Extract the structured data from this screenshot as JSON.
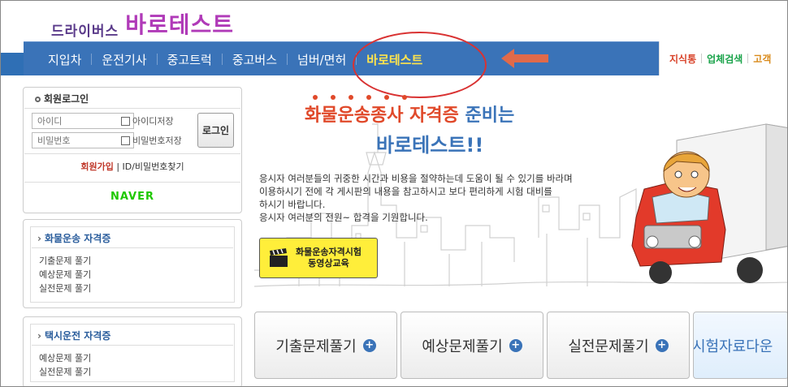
{
  "logo": {
    "sub": "드라이버스",
    "main": "바로테스트"
  },
  "nav": {
    "items": [
      "지입차",
      "운전기사",
      "중고트럭",
      "중고버스",
      "넘버/면허",
      "바로테스트"
    ],
    "right_items": [
      "지식통",
      "업체검색",
      "고객"
    ],
    "right_colors": [
      "#d9442b",
      "#1aa34a",
      "#d98a1a"
    ]
  },
  "login": {
    "title": "회원로그인",
    "id_placeholder": "아이디",
    "pw_placeholder": "비밀번호",
    "save_id": "아이디저장",
    "save_pw": "비밀번호저장",
    "login_button": "로그인",
    "join": "회원가입",
    "find": "ID/비밀번호찾기",
    "naver": "NAVER"
  },
  "categories": [
    {
      "title": "화물운송 자격증",
      "items": [
        "기출문제 풀기",
        "예상문제 풀기",
        "실전문제 풀기"
      ]
    },
    {
      "title": "택시운전 자격증",
      "items": [
        "예상문제 풀기",
        "실전문제 풀기"
      ]
    }
  ],
  "hero": {
    "title_red": "화물운송종사 자격증",
    "title_blue": "준비는",
    "title2": "바로테스트!!",
    "desc": [
      "응시자 여러분들의 귀중한 시간과 비용을 절약하는데 도움이 될 수 있기를 바라며",
      "이용하시기  전에 각 게시판의 내용을 참고하시고 보다 편리하게 시험 대비를",
      "하시기 바랍니다.",
      "응시자 여러분의 전원~ 합격을 기원합니다."
    ],
    "video_line1": "화물운송자격시험",
    "video_line2": "동영상교육"
  },
  "buttons": [
    "기출문제풀기",
    "예상문제풀기",
    "실전문제풀기",
    "시험자료다운"
  ],
  "colors": {
    "nav": "#3a73b8",
    "accent": "#e0492a",
    "active_nav": "#ffe44c"
  }
}
